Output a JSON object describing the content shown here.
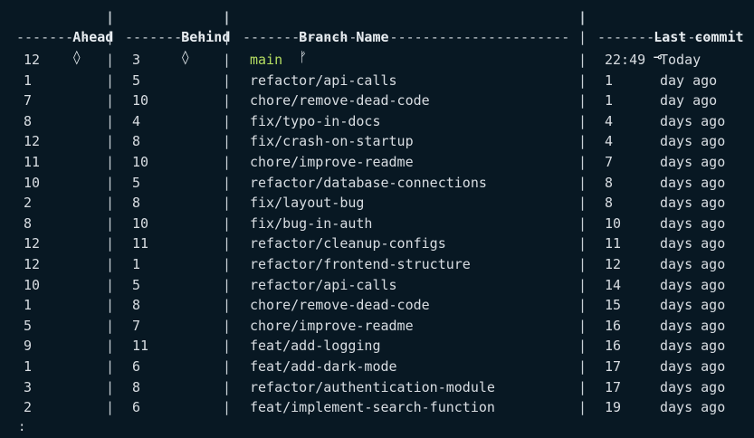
{
  "headers": {
    "ahead": "Ahead",
    "ahead_icon": "◊",
    "behind": "Behind",
    "behind_icon": "◊",
    "branch": "Branch Name",
    "branch_icon": "ᚠ",
    "commit": "Last commit",
    "commit_icon": "⊸"
  },
  "separators": {
    "ahead": "---------",
    "behind": "----------",
    "branch": "----------------------------------------",
    "commit": "--------------"
  },
  "rows": [
    {
      "ahead": "12",
      "behind": "3",
      "branch": "main",
      "commit_num": "22:49",
      "commit_text": "Today",
      "current": true
    },
    {
      "ahead": "1",
      "behind": "5",
      "branch": "refactor/api-calls",
      "commit_num": "1",
      "commit_text": "day ago"
    },
    {
      "ahead": "7",
      "behind": "10",
      "branch": "chore/remove-dead-code",
      "commit_num": "1",
      "commit_text": "day ago"
    },
    {
      "ahead": "8",
      "behind": "4",
      "branch": "fix/typo-in-docs",
      "commit_num": "4",
      "commit_text": "days ago"
    },
    {
      "ahead": "12",
      "behind": "8",
      "branch": "fix/crash-on-startup",
      "commit_num": "4",
      "commit_text": "days ago"
    },
    {
      "ahead": "11",
      "behind": "10",
      "branch": "chore/improve-readme",
      "commit_num": "7",
      "commit_text": "days ago"
    },
    {
      "ahead": "10",
      "behind": "5",
      "branch": "refactor/database-connections",
      "commit_num": "8",
      "commit_text": "days ago"
    },
    {
      "ahead": "2",
      "behind": "8",
      "branch": "fix/layout-bug",
      "commit_num": "8",
      "commit_text": "days ago"
    },
    {
      "ahead": "8",
      "behind": "10",
      "branch": "fix/bug-in-auth",
      "commit_num": "10",
      "commit_text": "days ago"
    },
    {
      "ahead": "12",
      "behind": "11",
      "branch": "refactor/cleanup-configs",
      "commit_num": "11",
      "commit_text": "days ago"
    },
    {
      "ahead": "12",
      "behind": "1",
      "branch": "refactor/frontend-structure",
      "commit_num": "12",
      "commit_text": "days ago"
    },
    {
      "ahead": "10",
      "behind": "5",
      "branch": "refactor/api-calls",
      "commit_num": "14",
      "commit_text": "days ago"
    },
    {
      "ahead": "1",
      "behind": "8",
      "branch": "chore/remove-dead-code",
      "commit_num": "15",
      "commit_text": "days ago"
    },
    {
      "ahead": "5",
      "behind": "7",
      "branch": "chore/improve-readme",
      "commit_num": "16",
      "commit_text": "days ago"
    },
    {
      "ahead": "9",
      "behind": "11",
      "branch": "feat/add-logging",
      "commit_num": "16",
      "commit_text": "days ago"
    },
    {
      "ahead": "1",
      "behind": "6",
      "branch": "feat/add-dark-mode",
      "commit_num": "17",
      "commit_text": "days ago"
    },
    {
      "ahead": "3",
      "behind": "8",
      "branch": "refactor/authentication-module",
      "commit_num": "17",
      "commit_text": "days ago"
    },
    {
      "ahead": "2",
      "behind": "6",
      "branch": "feat/implement-search-function",
      "commit_num": "19",
      "commit_text": "days ago"
    }
  ],
  "prompt": ":",
  "colors": {
    "background": "#081823",
    "current_branch": "#b5de62",
    "text": "#d8dde2"
  }
}
